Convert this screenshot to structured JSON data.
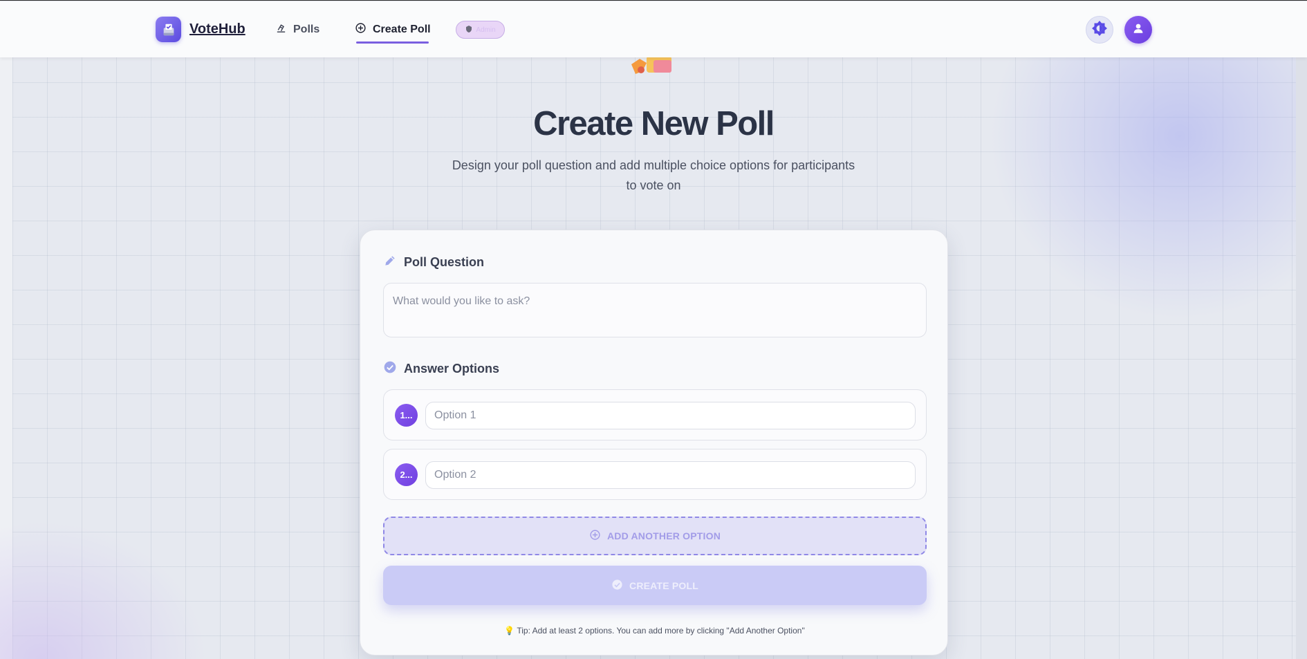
{
  "header": {
    "brand_name": "VoteHub",
    "nav": {
      "polls_label": "Polls",
      "create_label": "Create Poll"
    },
    "admin_badge": "Admin"
  },
  "hero": {
    "title": "Create New Poll",
    "subtitle": "Design your poll question and add multiple choice options for participants to vote on"
  },
  "form": {
    "question_label": "Poll Question",
    "question_placeholder": "What would you like to ask?",
    "options_label": "Answer Options",
    "options": [
      {
        "number": "1...",
        "placeholder": "Option 1"
      },
      {
        "number": "2...",
        "placeholder": "Option 2"
      }
    ],
    "add_option_label": "ADD ANOTHER OPTION",
    "create_label": "CREATE POLL",
    "tip": "Tip: Add at least 2 options. You can add more by clicking \"Add Another Option\""
  },
  "colors": {
    "accent": "#7a5fe0",
    "accent_dark": "#5b4be0",
    "title_text": "#2b3346",
    "button_disabled": "#cacbf6"
  },
  "icons": {
    "logo": "ballot-box-icon",
    "polls": "vote-icon",
    "create": "plus-circle-icon",
    "admin": "shield-icon",
    "theme": "brightness-icon",
    "user": "user-icon",
    "question": "pencil-icon",
    "options": "check-circle-icon"
  }
}
